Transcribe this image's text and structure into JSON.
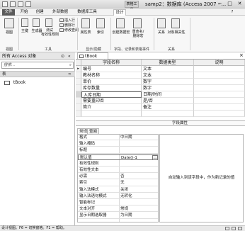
{
  "window": {
    "context_tab": "表格工具",
    "title": "samp2：数据库 (Access 2007 - ...",
    "controls": [
      "−",
      "□",
      "✕"
    ]
  },
  "tabs": [
    "文件",
    "开始",
    "创建",
    "外部数据",
    "数据库工具",
    "设计"
  ],
  "ribbon": {
    "views": "视图",
    "primary_key": "主键",
    "builder": "生成器",
    "test_rules": "测试\n有效性规则",
    "insert_rows": "插入行",
    "delete_rows": "删除行",
    "modify_lookups": "修改查阅",
    "property_sheet": "属性表",
    "indexes": "索引",
    "create_macros": "创建数据宏",
    "rename_delete_macro": "重命名/\n删除宏",
    "relationships": "关系",
    "object_dependencies": "对象相关性",
    "groups": [
      "视图",
      "工具",
      "显示/隐藏",
      "字段、记录和表格事件",
      "关系"
    ]
  },
  "nav": {
    "header": "所有 Access 对象",
    "search_placeholder": "搜索...",
    "category": "表",
    "items": [
      "tBook"
    ]
  },
  "doc": {
    "tab": "tBook",
    "columns": [
      "字段名称",
      "数据类型",
      "说明"
    ],
    "rows": [
      {
        "name": "编号",
        "type": "文本"
      },
      {
        "name": "教材名称",
        "type": "文本"
      },
      {
        "name": "单价",
        "type": "数字"
      },
      {
        "name": "库存数量",
        "type": "数字"
      },
      {
        "name": "入库日期",
        "type": "日期/时间"
      },
      {
        "name": "需要重印否",
        "type": "是/否"
      },
      {
        "name": "简介",
        "type": "备注"
      }
    ],
    "field_props_header": "字段属性",
    "prop_tabs": [
      "常规",
      "查阅"
    ],
    "props": [
      {
        "name": "格式",
        "value": "中日期"
      },
      {
        "name": "输入掩码",
        "value": ""
      },
      {
        "name": "标题",
        "value": ""
      },
      {
        "name": "默认值",
        "value": "Date()-1"
      },
      {
        "name": "有效性规则",
        "value": ""
      },
      {
        "name": "有效性文本",
        "value": ""
      },
      {
        "name": "必需",
        "value": "否"
      },
      {
        "name": "索引",
        "value": "无"
      },
      {
        "name": "输入法模式",
        "value": "关闭"
      },
      {
        "name": "输入法语句模式",
        "value": "无转化"
      },
      {
        "name": "智能标记",
        "value": ""
      },
      {
        "name": "文本对齐",
        "value": "常规"
      },
      {
        "name": "显示日期选取器",
        "value": "为日期"
      }
    ],
    "help_text": "自动输入到该字段中，作为新记录的值"
  },
  "status": {
    "text": "设计视图。F6 = 切换窗格。F1 = 帮助。"
  }
}
